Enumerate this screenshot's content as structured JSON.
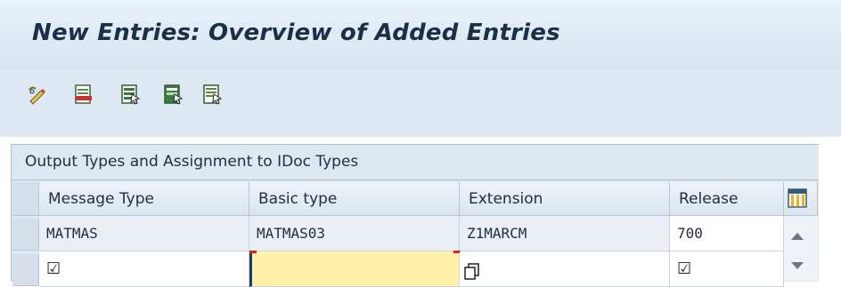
{
  "screen": {
    "title": "New Entries: Overview of Added Entries"
  },
  "toolbar": {
    "icons": [
      "change-display-icon",
      "delete-icon",
      "select-all-icon",
      "select-block-icon",
      "deselect-all-icon"
    ]
  },
  "table": {
    "caption": "Output Types and Assignment to IDoc Types",
    "columns": [
      "Message Type",
      "Basic type",
      "Extension",
      "Release"
    ],
    "rows": [
      {
        "message_type": "MATMAS",
        "basic_type": "MATMAS03",
        "extension": "Z1MARCM",
        "release": "700"
      },
      {
        "message_type": "☑",
        "basic_type": "",
        "extension": "",
        "release": "☑"
      }
    ]
  },
  "colors": {
    "title_bg": "#e2ecf6",
    "toolbar_bg": "#dde8f3",
    "active_cell": "#fff2a8",
    "title_text": "#1b2f47"
  }
}
